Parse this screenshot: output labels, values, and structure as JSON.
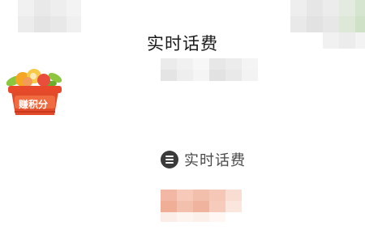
{
  "header": {
    "title": "实时话费"
  },
  "badge": {
    "label": "赚积分",
    "icon": "gift-basket-icon",
    "color": "#e8492a"
  },
  "section": {
    "icon": "list-icon",
    "label": "实时话费"
  },
  "colors": {
    "text_primary": "#1a1a1a",
    "text_secondary": "#4a4a4a",
    "blur_gray": "#e9e9e9",
    "blur_salmon": "#f2c4b4",
    "accent_green": "#cfe2c8"
  }
}
